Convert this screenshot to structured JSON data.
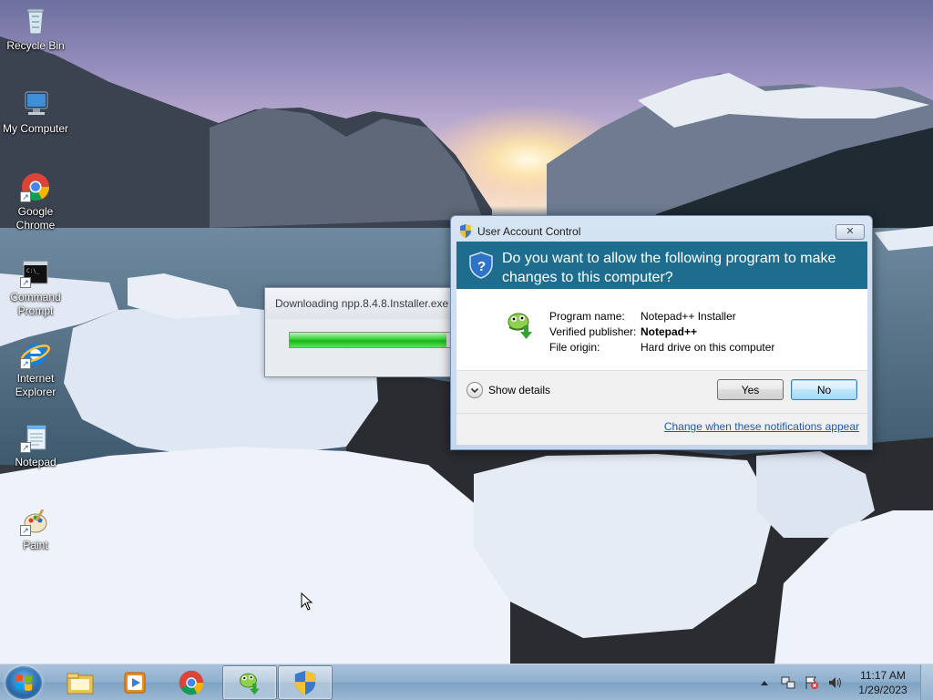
{
  "desktop": {
    "icons": [
      {
        "label": "Recycle Bin",
        "icon": "recycle-bin-icon"
      },
      {
        "label": "My Computer",
        "icon": "computer-icon"
      },
      {
        "label": "Google Chrome",
        "icon": "chrome-icon"
      },
      {
        "label": "Command Prompt",
        "icon": "command-prompt-icon"
      },
      {
        "label": "Internet Explorer",
        "icon": "internet-explorer-icon"
      },
      {
        "label": "Notepad",
        "icon": "notepad-icon"
      },
      {
        "label": "Paint",
        "icon": "paint-icon"
      }
    ]
  },
  "download_window": {
    "title": "Downloading npp.8.4.8.Installer.exe",
    "progress": 0.98
  },
  "uac": {
    "title": "User Account Control",
    "close_glyph": "✕",
    "question": "Do you want to allow the following program to make changes to this computer?",
    "program_name_label": "Program name:",
    "program_name_value": "Notepad++ Installer",
    "publisher_label": "Verified publisher:",
    "publisher_value": "Notepad++",
    "origin_label": "File origin:",
    "origin_value": "Hard drive on this computer",
    "show_details": "Show details",
    "yes": "Yes",
    "no": "No",
    "change_link": "Change when these notifications appear"
  },
  "taskbar": {
    "pinned": [
      "windows-explorer-icon",
      "media-player-icon",
      "chrome-icon",
      "notepad-plus-plus-icon",
      "uac-shield-icon"
    ],
    "time": "11:17 AM",
    "date": "1/29/2023"
  },
  "colors": {
    "uac_header": "#1e6d8f",
    "link": "#1f5ab0",
    "progress_green": "#19b519"
  }
}
